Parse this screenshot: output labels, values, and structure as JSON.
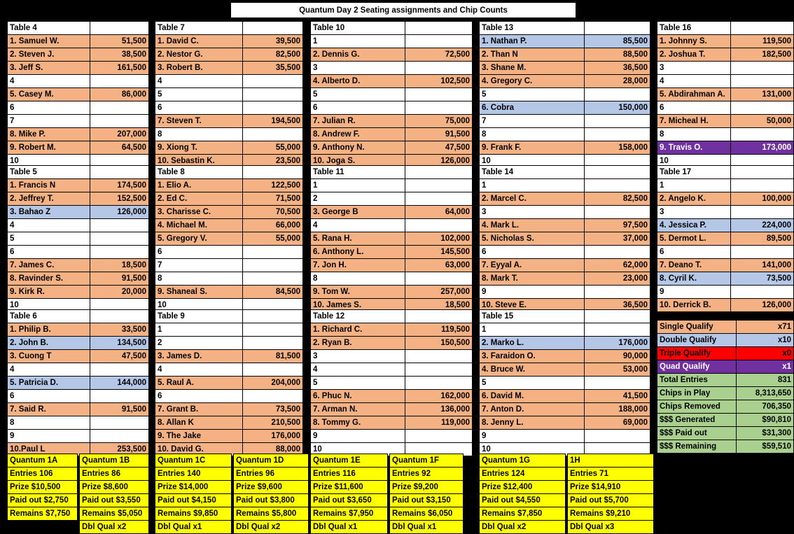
{
  "title": "Quantum Day 2 Seating assignments and Chip Counts",
  "legend_colors": {
    "single_qualify": "#F4B183",
    "double_qualify": "#B4C7E7",
    "triple_qualify": "#FF0000",
    "quad_qualify": "#7030A0",
    "totals": "#A9D08E",
    "flight": "#FFFF00"
  },
  "tables": [
    {
      "name": "Table 4",
      "seats": [
        {
          "label": "1. Samuel W.",
          "chips": "51,500",
          "status": "single"
        },
        {
          "label": "2. Steven J.",
          "chips": "38,500",
          "status": "single"
        },
        {
          "label": "3. Jeff S.",
          "chips": "161,500",
          "status": "single"
        },
        {
          "label": "4",
          "chips": "",
          "status": "empty"
        },
        {
          "label": "5. Casey M.",
          "chips": "86,000",
          "status": "single"
        },
        {
          "label": "6",
          "chips": "",
          "status": "empty"
        },
        {
          "label": "7",
          "chips": "",
          "status": "empty"
        },
        {
          "label": "8. Mike P.",
          "chips": "207,000",
          "status": "single"
        },
        {
          "label": "9. Robert M.",
          "chips": "64,500",
          "status": "single"
        },
        {
          "label": "10",
          "chips": "",
          "status": "empty"
        }
      ]
    },
    {
      "name": "Table 5",
      "seats": [
        {
          "label": "1. Francis N",
          "chips": "174,500",
          "status": "single"
        },
        {
          "label": "2. Jeffrey T.",
          "chips": "152,500",
          "status": "single"
        },
        {
          "label": "3. Bahao Z",
          "chips": "126,000",
          "status": "double"
        },
        {
          "label": "4",
          "chips": "",
          "status": "empty"
        },
        {
          "label": "5",
          "chips": "",
          "status": "empty"
        },
        {
          "label": "6",
          "chips": "",
          "status": "empty"
        },
        {
          "label": "7. James C.",
          "chips": "18,500",
          "status": "single"
        },
        {
          "label": "8. Ravinder S.",
          "chips": "91,500",
          "status": "single"
        },
        {
          "label": "9. Kirk R.",
          "chips": "20,000",
          "status": "single"
        },
        {
          "label": "10",
          "chips": "",
          "status": "empty"
        }
      ]
    },
    {
      "name": "Table 6",
      "seats": [
        {
          "label": "1. Philip B.",
          "chips": "33,500",
          "status": "single"
        },
        {
          "label": "2. John B.",
          "chips": "134,500",
          "status": "double"
        },
        {
          "label": "3. Cuong T",
          "chips": "47,500",
          "status": "single"
        },
        {
          "label": "4",
          "chips": "",
          "status": "empty"
        },
        {
          "label": "5. Patricia D.",
          "chips": "144,000",
          "status": "double"
        },
        {
          "label": "6",
          "chips": "",
          "status": "empty"
        },
        {
          "label": "7. Said R.",
          "chips": "91,500",
          "status": "single"
        },
        {
          "label": "8",
          "chips": "",
          "status": "empty"
        },
        {
          "label": "9",
          "chips": "",
          "status": "empty"
        },
        {
          "label": "10.Paul L",
          "chips": "253,500",
          "status": "single"
        }
      ]
    },
    {
      "name": "Table 7",
      "seats": [
        {
          "label": "1. David C.",
          "chips": "39,500",
          "status": "single"
        },
        {
          "label": "2. Nestor G.",
          "chips": "82,500",
          "status": "single"
        },
        {
          "label": "3. Robert B.",
          "chips": "35,500",
          "status": "single"
        },
        {
          "label": "4",
          "chips": "",
          "status": "empty"
        },
        {
          "label": "5",
          "chips": "",
          "status": "empty"
        },
        {
          "label": "6",
          "chips": "",
          "status": "empty"
        },
        {
          "label": "7. Steven T.",
          "chips": "194,500",
          "status": "single"
        },
        {
          "label": "8",
          "chips": "",
          "status": "empty"
        },
        {
          "label": "9. Xiong T.",
          "chips": "55,000",
          "status": "single"
        },
        {
          "label": "10. Sebastin K.",
          "chips": "23,500",
          "status": "single"
        }
      ]
    },
    {
      "name": "Table 8",
      "seats": [
        {
          "label": "1. Elio A.",
          "chips": "122,500",
          "status": "single"
        },
        {
          "label": "2. Ed C.",
          "chips": "71,500",
          "status": "single"
        },
        {
          "label": "3. Charisse C.",
          "chips": "70,500",
          "status": "single"
        },
        {
          "label": "4. Michael M.",
          "chips": "66,000",
          "status": "single"
        },
        {
          "label": "5. Gregory V.",
          "chips": "55,000",
          "status": "single"
        },
        {
          "label": "6",
          "chips": "",
          "status": "empty"
        },
        {
          "label": "7",
          "chips": "",
          "status": "empty"
        },
        {
          "label": "8",
          "chips": "",
          "status": "empty"
        },
        {
          "label": "9. Shaneal S.",
          "chips": "84,500",
          "status": "single"
        },
        {
          "label": "10",
          "chips": "",
          "status": "empty"
        }
      ]
    },
    {
      "name": "Table 9",
      "seats": [
        {
          "label": "1",
          "chips": "",
          "status": "empty"
        },
        {
          "label": "2",
          "chips": "",
          "status": "empty"
        },
        {
          "label": "3. James D.",
          "chips": "81,500",
          "status": "single"
        },
        {
          "label": "4",
          "chips": "",
          "status": "empty"
        },
        {
          "label": "5. Raul A.",
          "chips": "204,000",
          "status": "single"
        },
        {
          "label": "6",
          "chips": "",
          "status": "empty"
        },
        {
          "label": "7. Grant B.",
          "chips": "73,500",
          "status": "single"
        },
        {
          "label": "8. Allan K",
          "chips": "210,500",
          "status": "single"
        },
        {
          "label": "9. The Jake",
          "chips": "176,000",
          "status": "single"
        },
        {
          "label": "10. David G.",
          "chips": "88,000",
          "status": "single"
        }
      ]
    },
    {
      "name": "Table 10",
      "seats": [
        {
          "label": "1",
          "chips": "",
          "status": "empty"
        },
        {
          "label": "2. Dennis G.",
          "chips": "72,500",
          "status": "single"
        },
        {
          "label": "3",
          "chips": "",
          "status": "empty"
        },
        {
          "label": "4. Alberto D.",
          "chips": "102,500",
          "status": "single"
        },
        {
          "label": "5",
          "chips": "",
          "status": "empty"
        },
        {
          "label": "6",
          "chips": "",
          "status": "empty"
        },
        {
          "label": "7. Julian R.",
          "chips": "75,000",
          "status": "single"
        },
        {
          "label": "8. Andrew F.",
          "chips": "91,500",
          "status": "single"
        },
        {
          "label": "9. Anthony N.",
          "chips": "47,500",
          "status": "single"
        },
        {
          "label": "10. Joga S.",
          "chips": "126,000",
          "status": "single"
        }
      ]
    },
    {
      "name": "Table 11",
      "seats": [
        {
          "label": "1",
          "chips": "",
          "status": "empty"
        },
        {
          "label": "2",
          "chips": "",
          "status": "empty"
        },
        {
          "label": "3. George B",
          "chips": "64,000",
          "status": "single"
        },
        {
          "label": "4",
          "chips": "",
          "status": "empty"
        },
        {
          "label": "5. Rana H.",
          "chips": "102,000",
          "status": "single"
        },
        {
          "label": "6. Anthony L.",
          "chips": "145,500",
          "status": "single"
        },
        {
          "label": "7. Jon H.",
          "chips": "63,000",
          "status": "single"
        },
        {
          "label": "8",
          "chips": "",
          "status": "empty"
        },
        {
          "label": "9. Tom W.",
          "chips": "257,000",
          "status": "single"
        },
        {
          "label": "10. James S.",
          "chips": "18,500",
          "status": "single"
        }
      ]
    },
    {
      "name": "Table 12",
      "seats": [
        {
          "label": "1. Richard C.",
          "chips": "119,500",
          "status": "single"
        },
        {
          "label": "2. Ryan B.",
          "chips": "150,500",
          "status": "single"
        },
        {
          "label": "3",
          "chips": "",
          "status": "empty"
        },
        {
          "label": "4",
          "chips": "",
          "status": "empty"
        },
        {
          "label": "5",
          "chips": "",
          "status": "empty"
        },
        {
          "label": "6. Phuc N.",
          "chips": "162,000",
          "status": "single"
        },
        {
          "label": "7. Arman N.",
          "chips": "136,000",
          "status": "single"
        },
        {
          "label": "8. Tommy G.",
          "chips": "119,000",
          "status": "single"
        },
        {
          "label": "9",
          "chips": "",
          "status": "empty"
        },
        {
          "label": "10",
          "chips": "",
          "status": "empty"
        }
      ]
    },
    {
      "name": "Table 13",
      "seats": [
        {
          "label": "1. Nathan P.",
          "chips": "85,500",
          "status": "double"
        },
        {
          "label": "2. Than N",
          "chips": "88,500",
          "status": "single"
        },
        {
          "label": "3. Shane M.",
          "chips": "36,500",
          "status": "single"
        },
        {
          "label": "4. Gregory C.",
          "chips": "28,000",
          "status": "single"
        },
        {
          "label": "5",
          "chips": "",
          "status": "empty"
        },
        {
          "label": "6. Cobra",
          "chips": "150,000",
          "status": "double"
        },
        {
          "label": "7",
          "chips": "",
          "status": "empty"
        },
        {
          "label": "8",
          "chips": "",
          "status": "empty"
        },
        {
          "label": "9. Frank F.",
          "chips": "158,000",
          "status": "single"
        },
        {
          "label": "10",
          "chips": "",
          "status": "empty"
        }
      ]
    },
    {
      "name": "Table 14",
      "seats": [
        {
          "label": "1",
          "chips": "",
          "status": "empty"
        },
        {
          "label": "2. Marcel C.",
          "chips": "82,500",
          "status": "single"
        },
        {
          "label": "3",
          "chips": "",
          "status": "empty"
        },
        {
          "label": "4. Mark L.",
          "chips": "97,500",
          "status": "single"
        },
        {
          "label": "5. Nicholas S.",
          "chips": "37,000",
          "status": "single"
        },
        {
          "label": "6",
          "chips": "",
          "status": "empty"
        },
        {
          "label": "7. Eyyal A.",
          "chips": "62,000",
          "status": "single"
        },
        {
          "label": "8. Mark T.",
          "chips": "23,000",
          "status": "single"
        },
        {
          "label": "9",
          "chips": "",
          "status": "empty"
        },
        {
          "label": "10. Steve E.",
          "chips": "36,500",
          "status": "single"
        }
      ]
    },
    {
      "name": "Table 15",
      "seats": [
        {
          "label": "1",
          "chips": "",
          "status": "empty"
        },
        {
          "label": "2. Marko L.",
          "chips": "176,000",
          "status": "double"
        },
        {
          "label": "3. Faraidon O.",
          "chips": "90,000",
          "status": "single"
        },
        {
          "label": "4. Bruce W.",
          "chips": "53,000",
          "status": "single"
        },
        {
          "label": "5",
          "chips": "",
          "status": "empty"
        },
        {
          "label": "6. David M.",
          "chips": "41,500",
          "status": "single"
        },
        {
          "label": "7. Anton D.",
          "chips": "188,000",
          "status": "single"
        },
        {
          "label": "8. Jenny L.",
          "chips": "69,000",
          "status": "single"
        },
        {
          "label": "9",
          "chips": "",
          "status": "empty"
        },
        {
          "label": "10",
          "chips": "",
          "status": "empty"
        }
      ]
    },
    {
      "name": "Table 16",
      "seats": [
        {
          "label": "1. Johnny S.",
          "chips": "119,500",
          "status": "single"
        },
        {
          "label": "2. Joshua T.",
          "chips": "182,500",
          "status": "single"
        },
        {
          "label": "3",
          "chips": "",
          "status": "empty"
        },
        {
          "label": "4",
          "chips": "",
          "status": "empty"
        },
        {
          "label": "5. Abdirahman A.",
          "chips": "131,000",
          "status": "single"
        },
        {
          "label": "6",
          "chips": "",
          "status": "empty"
        },
        {
          "label": "7. Micheal H.",
          "chips": "50,000",
          "status": "single"
        },
        {
          "label": "8",
          "chips": "",
          "status": "empty"
        },
        {
          "label": "9. Travis O.",
          "chips": "173,000",
          "status": "quad"
        },
        {
          "label": "10",
          "chips": "",
          "status": "empty"
        }
      ]
    },
    {
      "name": "Table 17",
      "seats": [
        {
          "label": "1",
          "chips": "",
          "status": "empty"
        },
        {
          "label": "2. Angelo K.",
          "chips": "100,000",
          "status": "single"
        },
        {
          "label": "3",
          "chips": "",
          "status": "empty"
        },
        {
          "label": "4. Jessica P.",
          "chips": "224,000",
          "status": "double"
        },
        {
          "label": "5. Dermot L.",
          "chips": "89,500",
          "status": "single"
        },
        {
          "label": "6",
          "chips": "",
          "status": "empty"
        },
        {
          "label": "7. Deano T.",
          "chips": "141,000",
          "status": "single"
        },
        {
          "label": "8. Cyril K.",
          "chips": "73,500",
          "status": "double"
        },
        {
          "label": "9",
          "chips": "",
          "status": "empty"
        },
        {
          "label": "10. Derrick B.",
          "chips": "126,000",
          "status": "single"
        }
      ]
    }
  ],
  "summary": {
    "rows": [
      {
        "label": "Single Qualify",
        "value": "x71",
        "style": "orange"
      },
      {
        "label": "Double Qualify",
        "value": "x10",
        "style": "blue"
      },
      {
        "label": "Triple Qualify",
        "value": "x0",
        "style": "red"
      },
      {
        "label": "Quad Qualify",
        "value": "x1",
        "style": "purple"
      },
      {
        "label": "Total Entries",
        "value": "831",
        "style": "green"
      },
      {
        "label": "Chips in Play",
        "value": "8,313,650",
        "style": "green"
      },
      {
        "label": "Chips Removed",
        "value": "706,350",
        "style": "green"
      },
      {
        "label": "$$$ Generated",
        "value": "$90,810",
        "style": "green"
      },
      {
        "label": "$$$ Paid out",
        "value": "$31,300",
        "style": "green"
      },
      {
        "label": "$$$ Remaining",
        "value": "$59,510",
        "style": "green"
      }
    ]
  },
  "flights": [
    {
      "name": "Quantum 1A",
      "entries": "Entries 106",
      "prize": "Prize $10,500",
      "paid": "Paid out $2,750",
      "remains": "Remains $7,750",
      "dbl": ""
    },
    {
      "name": "Quantum 1B",
      "entries": "Entries 86",
      "prize": "Prize $8,600",
      "paid": "Paid out $3,550",
      "remains": "Remains $5,050",
      "dbl": "Dbl Qual x2"
    },
    {
      "name": "Quantum 1C",
      "entries": "Entries 140",
      "prize": "Prize $14,000",
      "paid": "Paid out $4,150",
      "remains": "Remains $9,850",
      "dbl": "Dbl Qual x1"
    },
    {
      "name": "Quantum 1D",
      "entries": "Entries 96",
      "prize": "Prize $9,600",
      "paid": "Paid out $3,800",
      "remains": "Remains $5,800",
      "dbl": "Dbl Qual x2"
    },
    {
      "name": "Quantum 1E",
      "entries": "Entries 116",
      "prize": "Prize $11,600",
      "paid": "Paid out $3,650",
      "remains": "Remains $7,950",
      "dbl": "Dbl Qual x1"
    },
    {
      "name": "Quantum 1F",
      "entries": "Entries 92",
      "prize": "Prize $9,200",
      "paid": "Paid out $3,150",
      "remains": "Remains $6,050",
      "dbl": "Dbl Qual x1"
    },
    {
      "name": "Quantum 1G",
      "entries": "Entries 124",
      "prize": "Prize $12,400",
      "paid": "Paid out $4,550",
      "remains": "Remains $7,850",
      "dbl": "Dbl Qual x2"
    },
    {
      "name": "1H",
      "entries": "Entries  71",
      "prize": "Prize $14,910",
      "paid": "Paid out $5,700",
      "remains": "Remains $9,210",
      "dbl": "Dbl Qual x3"
    }
  ]
}
